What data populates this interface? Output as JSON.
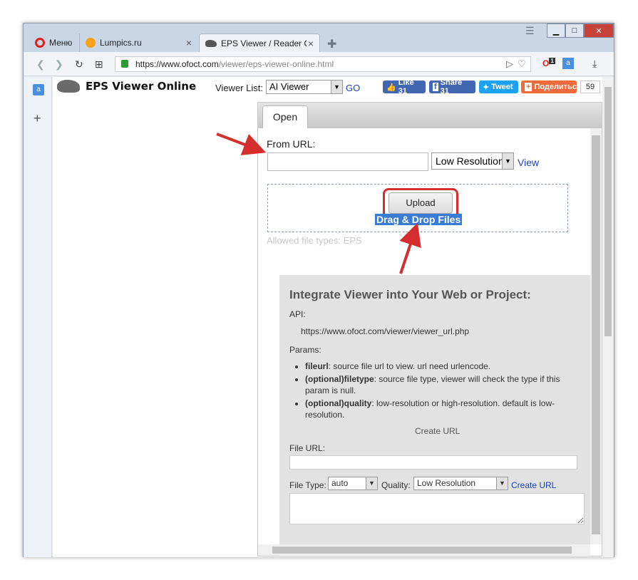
{
  "browser": {
    "menu_label": "Меню",
    "tabs": [
      {
        "title": "Lumpics.ru"
      },
      {
        "title": "EPS Viewer / Reader Online"
      }
    ],
    "url_host": "https://www.ofoct.com",
    "url_path": "/viewer/eps-viewer-online.html",
    "opera_badge": "1"
  },
  "site": {
    "logo": "EPS Viewer Online",
    "viewer_list_label": "Viewer List:",
    "viewer_selected": "AI Viewer",
    "go": "GO",
    "social": {
      "like": "Like 31",
      "share": "Share 31",
      "tweet": "Tweet",
      "ok": "Поделиться",
      "count": "59"
    }
  },
  "viewer": {
    "tab_open": "Open",
    "from_url": "From URL:",
    "url_value": "",
    "resolution": "Low Resolution",
    "view": "View",
    "upload": "Upload",
    "drag_drop": "Drag & Drop Files",
    "allowed": "Allowed file types: EPS"
  },
  "integrate": {
    "title": "Integrate Viewer into Your Web or Project:",
    "api_label": "API:",
    "api_url": "https://www.ofoct.com/viewer/viewer_url.php",
    "params_label": "Params:",
    "params": [
      {
        "name": "fileurl",
        "desc": ": source file url to view. url need urlencode."
      },
      {
        "name": "(optional)filetype",
        "desc": ": source file type, viewer will check the type if this param is null."
      },
      {
        "name": "(optional)quality",
        "desc": ": low-resolution or high-resolution. default is low-resolution."
      }
    ],
    "create_url_heading": "Create URL",
    "file_url_label": "File URL:",
    "file_type_label": "File Type:",
    "file_type_value": "auto",
    "quality_label": "Quality:",
    "quality_value": "Low Resolution",
    "create_url_link": "Create URL"
  },
  "colors": {
    "annotation_red": "#d42e2e",
    "link_blue": "#1a3fc4",
    "facebook": "#4267b2",
    "twitter": "#1da1f2",
    "ok": "#ee6a3d"
  }
}
